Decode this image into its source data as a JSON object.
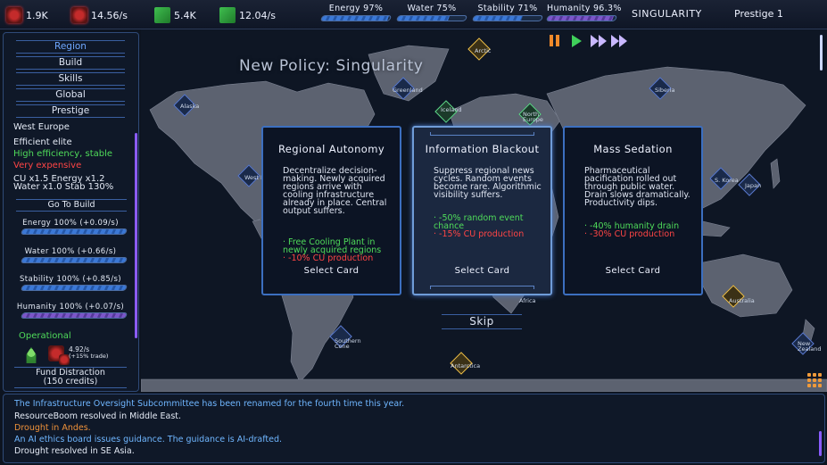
{
  "topbar": {
    "resources": [
      {
        "name": "cu",
        "icon": "cpu-icon",
        "value": "1.9K"
      },
      {
        "name": "cu_rate",
        "icon": "cpu-plus-icon",
        "value": "14.56/s"
      },
      {
        "name": "money",
        "icon": "money-icon",
        "value": "5.4K"
      },
      {
        "name": "money_rate",
        "icon": "money-plus-icon",
        "value": "12.04/s"
      }
    ],
    "stats": [
      {
        "label": "Energy 97%",
        "level": 0.97
      },
      {
        "label": "Water 75%",
        "level": 0.75
      },
      {
        "label": "Stability 71%",
        "level": 0.71
      },
      {
        "label": "Humanity 96.3%",
        "level": 0.963
      }
    ],
    "era": "SINGULARITY",
    "prestige": "Prestige 1"
  },
  "leftpanel": {
    "nav": [
      "Region",
      "Build",
      "Skills",
      "Global",
      "Prestige"
    ],
    "region_name": "West Europe",
    "tier": "Efficient elite",
    "pro": "High efficiency, stable",
    "con": "Very expensive",
    "mult_line1": "CU x1.5  Energy x1.2",
    "mult_line2": "Water x1.0  Stab 130%",
    "goto_label": "Go To Build",
    "region_bars": [
      {
        "label": "Energy 100% (+0.09/s)",
        "level": 1.0
      },
      {
        "label": "Water 100% (+0.66/s)",
        "level": 1.0
      },
      {
        "label": "Stability 100% (+0.85/s)",
        "level": 1.0
      },
      {
        "label": "Humanity 100% (+0.07/s)",
        "level": 1.0
      }
    ],
    "status": "Operational",
    "cu_rate": "4.92/s",
    "trade": "(+15% trade)",
    "fund_label_1": "Fund Distraction",
    "fund_label_2": "(150 credits)"
  },
  "map": {
    "policy_title": "New Policy: Singularity",
    "labels": [
      "Arctic",
      "Greenland",
      "Siberia",
      "Alaska",
      "Iceland",
      "North Europe",
      "West Eur",
      "S. Korea",
      "Japan",
      "Africa",
      "Australia",
      "Southern Cone",
      "Antarctica",
      "New Zealand"
    ]
  },
  "cards": [
    {
      "title": "Regional Autonomy",
      "desc": "Decentralize decision-making. Newly acquired regions arrive with cooling infrastructure already in place. Central output suffers.",
      "eff_green": "· Free Cooling Plant in newly acquired regions",
      "eff_red": "· -10% CU production",
      "select": "Select Card"
    },
    {
      "title": "Information Blackout",
      "desc": "Suppress regional news cycles. Random events become rare. Algorithmic visibility suffers.",
      "eff_green": "· -50% random event chance",
      "eff_red": "· -15% CU production",
      "select": "Select Card"
    },
    {
      "title": "Mass Sedation",
      "desc": "Pharmaceutical pacification rolled out through public water. Drain slows dramatically. Productivity dips.",
      "eff_green": "· -40% humanity drain",
      "eff_red": "· -30% CU production",
      "select": "Select Card"
    }
  ],
  "skip_label": "Skip",
  "log": [
    {
      "text": "The Infrastructure Oversight Subcommittee has been renamed for the fourth time this year.",
      "color": "#6fb6ff"
    },
    {
      "text": "ResourceBoom resolved in Middle East.",
      "color": "#e4eaf5"
    },
    {
      "text": "Drought in Andes.",
      "color": "#f0923a"
    },
    {
      "text": "An AI ethics board issues guidance. The guidance is AI-drafted.",
      "color": "#6fb6ff"
    },
    {
      "text": "Drought resolved in SE Asia.",
      "color": "#e4eaf5"
    }
  ]
}
